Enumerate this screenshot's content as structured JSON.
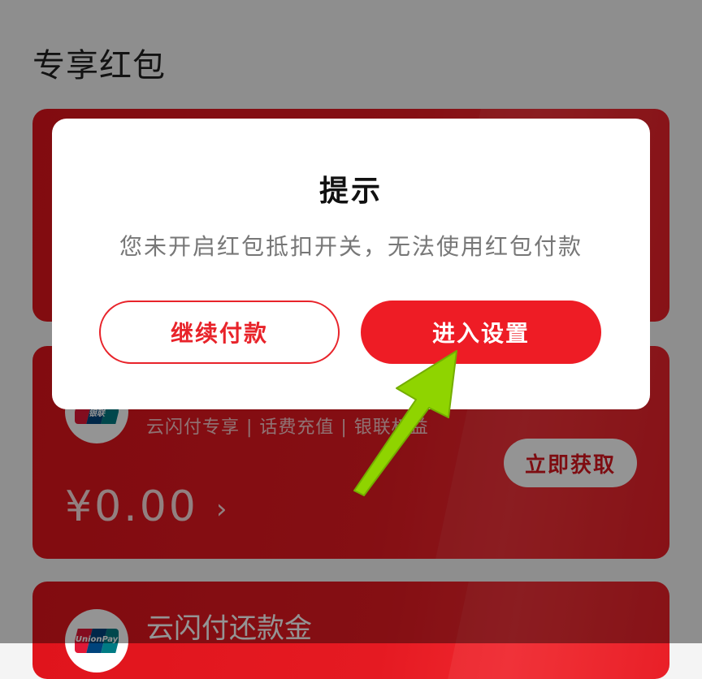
{
  "page": {
    "section_title": "专享红包"
  },
  "cards": [
    {
      "subtitle": "云闪付专享 | 话费充值 | 银联权益",
      "amount": "¥0.00",
      "chevron": "›",
      "action_label": "立即获取",
      "logo_text": "银联"
    },
    {
      "title": "云闪付还款金",
      "logo_text": "UnionPay"
    }
  ],
  "dialog": {
    "title": "提示",
    "message": "您未开启红包抵扣开关，无法使用红包付款",
    "continue_label": "继续付款",
    "settings_label": "进入设置"
  },
  "colors": {
    "brand_red": "#e51a22",
    "button_red": "#ee1c25",
    "annotation_arrow": "#8fd400"
  },
  "icons": {
    "unionpay_logo": "unionpay-logo-icon",
    "chevron": "chevron-right-icon",
    "annotation": "green-arrow-icon"
  }
}
